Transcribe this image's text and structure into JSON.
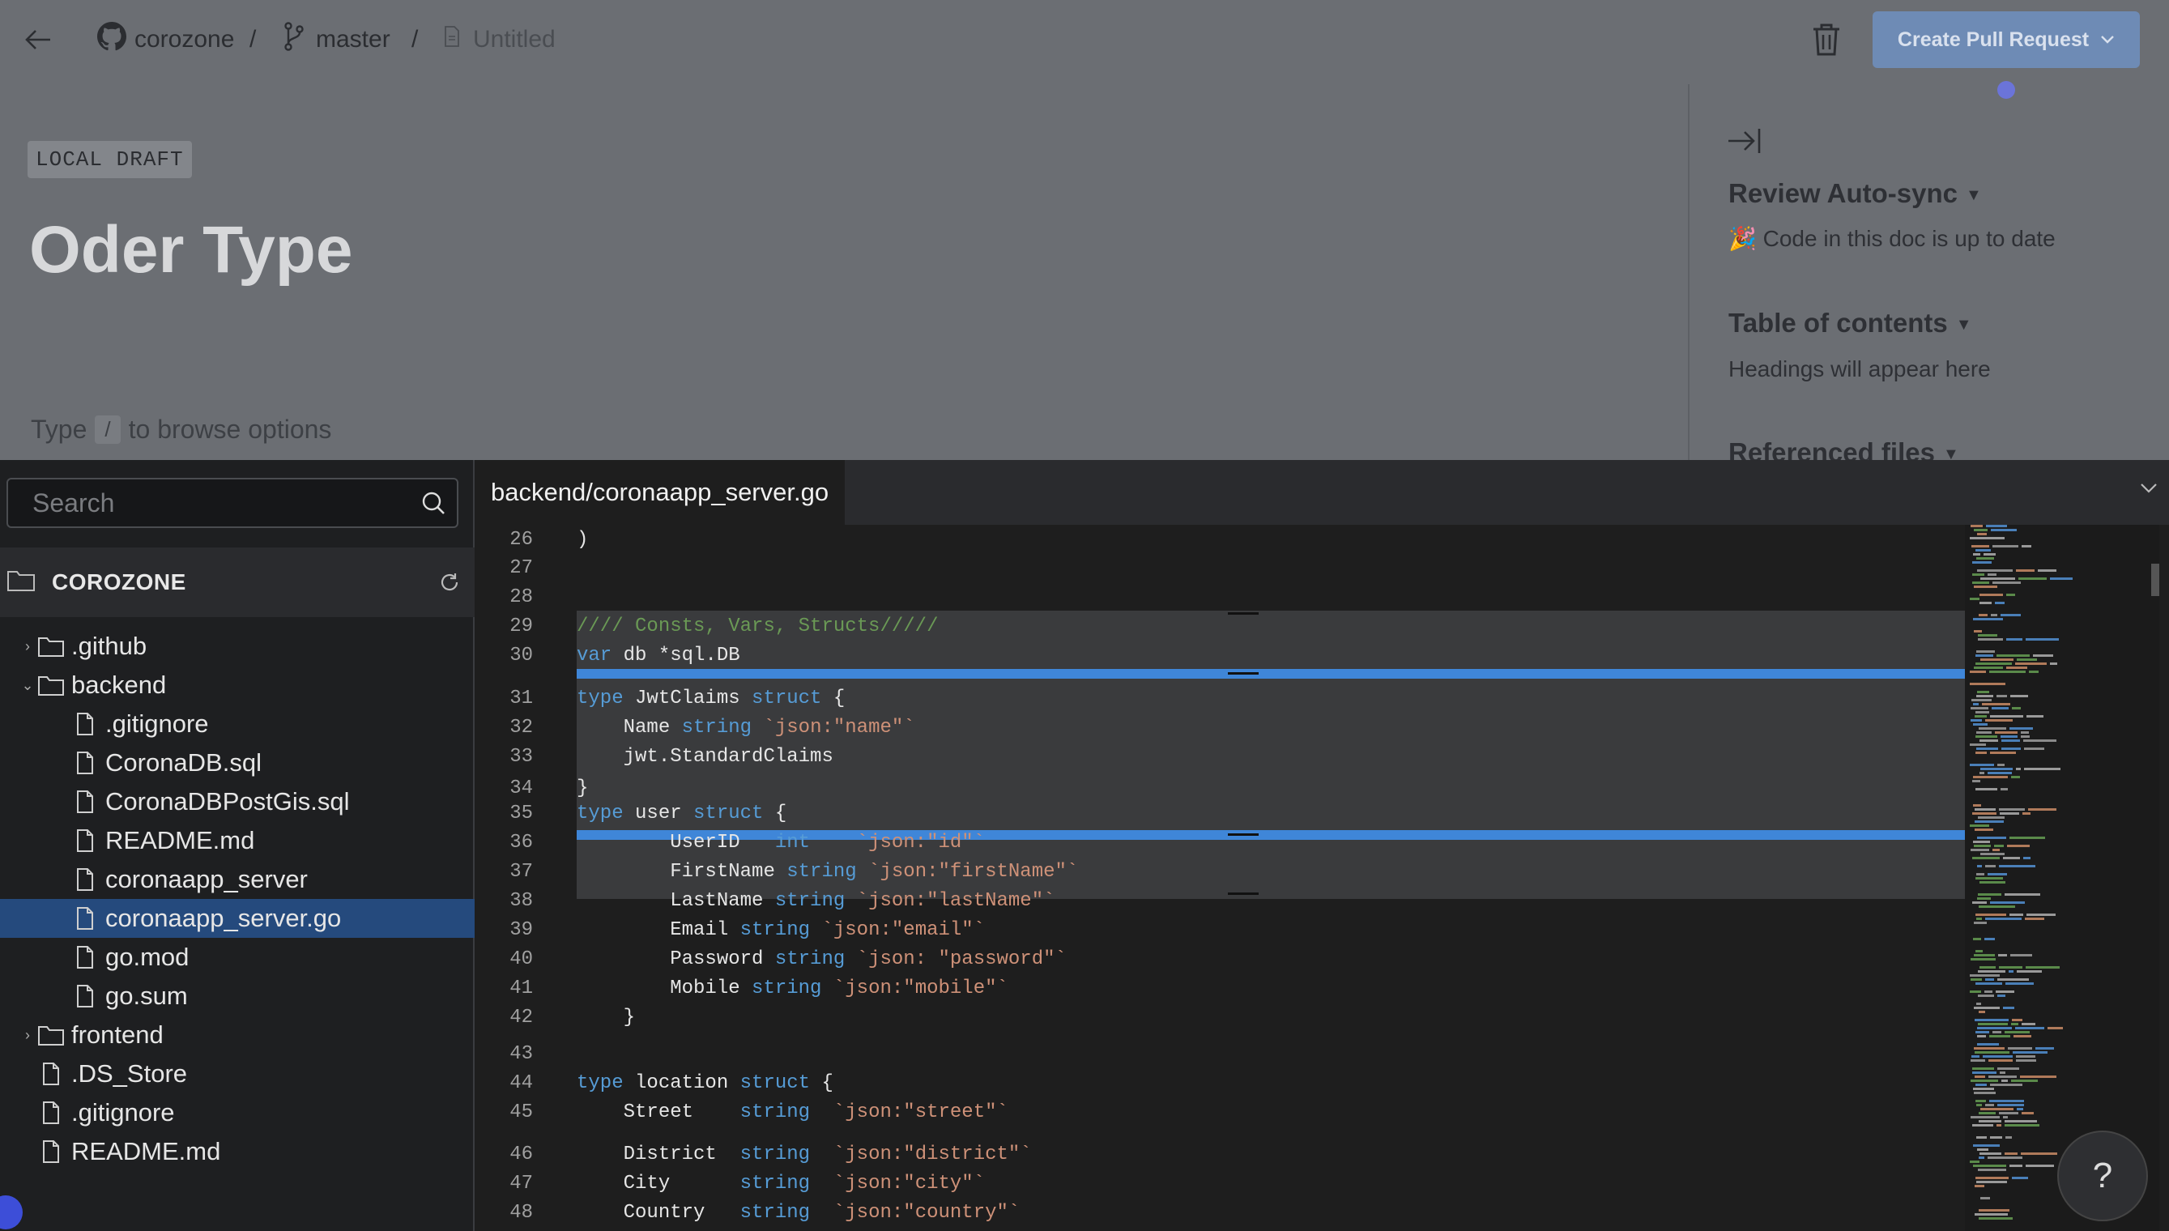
{
  "topbar": {
    "repo": "corozone",
    "branch": "master",
    "file": "Untitled",
    "separator": "/",
    "create_pr_label": "Create Pull Request"
  },
  "doc": {
    "badge": "LOCAL DRAFT",
    "title": "Oder Type",
    "hint_before": "Type",
    "hint_key": "/",
    "hint_after": "to browse options"
  },
  "right_panel": {
    "autosync_heading": "Review Auto-sync",
    "autosync_status": "🎉 Code in this doc is up to date",
    "toc_heading": "Table of contents",
    "toc_text": "Headings will appear here",
    "referenced_heading": "Referenced files"
  },
  "explorer": {
    "search_placeholder": "Search",
    "root_label": "COROZONE",
    "items": [
      {
        "label": ".github",
        "type": "folder",
        "expanded": false,
        "indent": 0
      },
      {
        "label": "backend",
        "type": "folder",
        "expanded": true,
        "indent": 0
      },
      {
        "label": ".gitignore",
        "type": "file",
        "indent": 1
      },
      {
        "label": "CoronaDB.sql",
        "type": "file",
        "indent": 1
      },
      {
        "label": "CoronaDBPostGis.sql",
        "type": "file",
        "indent": 1
      },
      {
        "label": "README.md",
        "type": "file",
        "indent": 1
      },
      {
        "label": "coronaapp_server",
        "type": "file",
        "indent": 1
      },
      {
        "label": "coronaapp_server.go",
        "type": "file",
        "indent": 1,
        "selected": true
      },
      {
        "label": "go.mod",
        "type": "file",
        "indent": 1
      },
      {
        "label": "go.sum",
        "type": "file",
        "indent": 1
      },
      {
        "label": "frontend",
        "type": "folder",
        "expanded": false,
        "indent": 0
      },
      {
        "label": ".DS_Store",
        "type": "file",
        "indent": 0
      },
      {
        "label": ".gitignore",
        "type": "file",
        "indent": 0
      },
      {
        "label": "README.md",
        "type": "file",
        "indent": 0
      }
    ]
  },
  "editor": {
    "tab_label": "backend/coronaapp_server.go",
    "lines": [
      {
        "n": "26",
        "text": ")"
      },
      {
        "n": "27",
        "text": ""
      },
      {
        "n": "28",
        "text": ""
      },
      {
        "n": "29",
        "text": "//// Consts, Vars, Structs/////"
      },
      {
        "n": "30",
        "text": "var db *sql.DB"
      },
      {
        "n": "31",
        "text": "type JwtClaims struct {"
      },
      {
        "n": "32",
        "text": "    Name string `json:\"name\"`"
      },
      {
        "n": "33",
        "text": "    jwt.StandardClaims"
      },
      {
        "n": "34",
        "text": "}"
      },
      {
        "n": "35",
        "text": "type user struct {"
      },
      {
        "n": "36",
        "text": "        UserID   int    `json:\"id\"`"
      },
      {
        "n": "37",
        "text": "        FirstName string `json:\"firstName\"`"
      },
      {
        "n": "38",
        "text": "        LastName string `json:\"lastName\"`"
      },
      {
        "n": "39",
        "text": "        Email string `json:\"email\"`"
      },
      {
        "n": "40",
        "text": "        Password string `json: \"password\"`"
      },
      {
        "n": "41",
        "text": "        Mobile string `json:\"mobile\"`"
      },
      {
        "n": "42",
        "text": "    }"
      },
      {
        "n": "43",
        "text": ""
      },
      {
        "n": "44",
        "text": "type location struct {"
      },
      {
        "n": "45",
        "text": "    Street    string  `json:\"street\"`"
      },
      {
        "n": "46",
        "text": "    District  string  `json:\"district\"`"
      },
      {
        "n": "47",
        "text": "    City      string  `json:\"city\"`"
      },
      {
        "n": "48",
        "text": "    Country   string  `json:\"country\"`"
      }
    ]
  },
  "help_label": "?",
  "colors": {
    "accent": "#3f86d8",
    "selected_row": "#254a7d",
    "keyword": "#569cd6",
    "comment": "#6a9955",
    "string": "#ce9178"
  }
}
